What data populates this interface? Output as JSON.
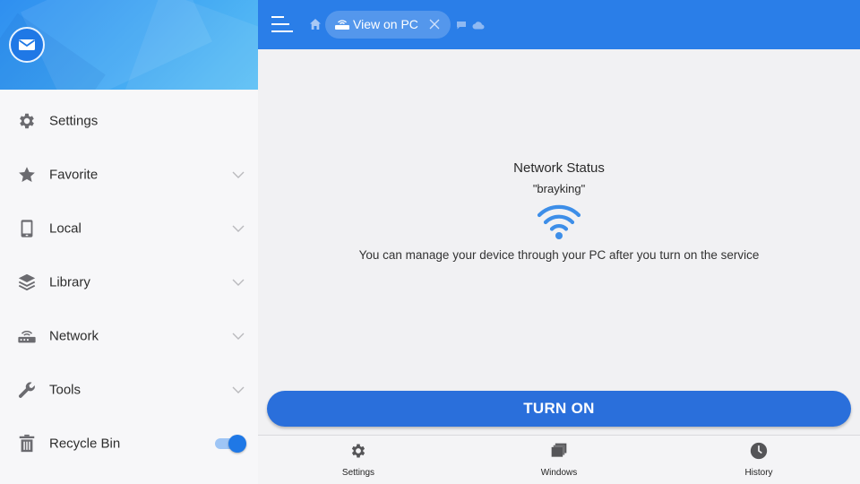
{
  "sidebar": {
    "items": [
      {
        "label": "Settings",
        "icon": "gear-icon",
        "expandable": false
      },
      {
        "label": "Favorite",
        "icon": "star-icon",
        "expandable": true
      },
      {
        "label": "Local",
        "icon": "phone-icon",
        "expandable": true
      },
      {
        "label": "Library",
        "icon": "layers-icon",
        "expandable": true
      },
      {
        "label": "Network",
        "icon": "router-icon",
        "expandable": true
      },
      {
        "label": "Tools",
        "icon": "wrench-icon",
        "expandable": true
      },
      {
        "label": "Recycle Bin",
        "icon": "trash-icon",
        "toggle": true
      }
    ],
    "recycle_bin_enabled": true
  },
  "topbar": {
    "tab_label": "View on PC"
  },
  "main": {
    "title": "Network Status",
    "network_name": "\"brayking\"",
    "description": "You can manage your device through your PC after you turn on the service",
    "button_label": "TURN ON"
  },
  "bottom_nav": [
    {
      "label": "Settings",
      "icon": "gear-icon"
    },
    {
      "label": "Windows",
      "icon": "windows-stack-icon"
    },
    {
      "label": "History",
      "icon": "clock-icon"
    }
  ],
  "colors": {
    "accent": "#2a7ee8",
    "button": "#2a6fdb",
    "wifi": "#3d8ee8",
    "icon_gray": "#6b6b70"
  }
}
